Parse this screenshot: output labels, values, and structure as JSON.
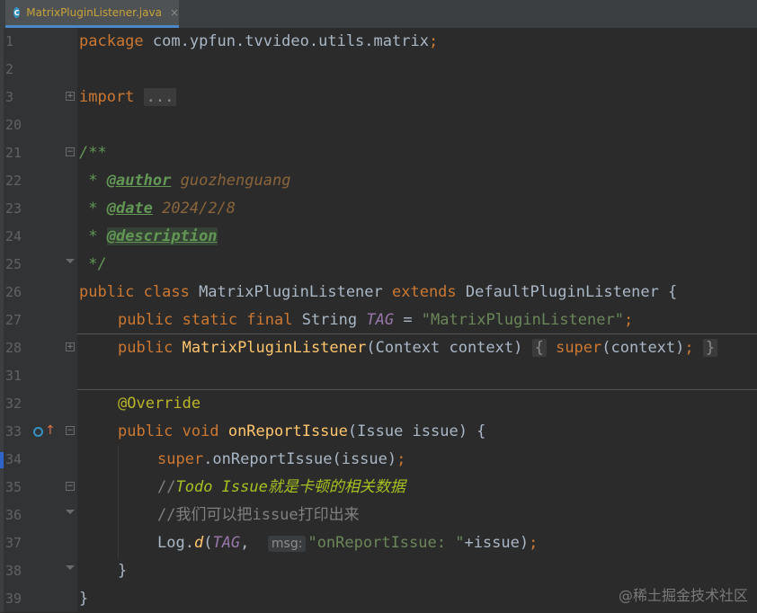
{
  "tab": {
    "icon": "java-class-icon",
    "icon_letter": "C",
    "label": "MatrixPluginListener.java",
    "close": "×"
  },
  "lines": [
    {
      "n": "1"
    },
    {
      "n": "2"
    },
    {
      "n": "3"
    },
    {
      "n": "20"
    },
    {
      "n": "21"
    },
    {
      "n": "22"
    },
    {
      "n": "23"
    },
    {
      "n": "24"
    },
    {
      "n": "25"
    },
    {
      "n": "26"
    },
    {
      "n": "27"
    },
    {
      "n": "28"
    },
    {
      "n": "31"
    },
    {
      "n": "32"
    },
    {
      "n": "33"
    },
    {
      "n": "34"
    },
    {
      "n": "35"
    },
    {
      "n": "36"
    },
    {
      "n": "37"
    },
    {
      "n": "38"
    },
    {
      "n": "39"
    }
  ],
  "code": {
    "l1_kw": "package",
    "l1_pkg": " com.ypfun.tvvideo.utils.matrix",
    "l1_semi": ";",
    "l3_kw": "import",
    "l3_folded": "...",
    "l21": "/**",
    "l22_star": " * ",
    "l22_tag": "@author",
    "l22_val": " guozhenguang",
    "l23_star": " * ",
    "l23_tag": "@date",
    "l23_val": " 2024/2/8",
    "l24_star": " * ",
    "l24_tag": "@description",
    "l25": " */",
    "l26_kw1": "public class ",
    "l26_name": "MatrixPluginListener ",
    "l26_kw2": "extends ",
    "l26_rest": "DefaultPluginListener {",
    "l27_kw": "public static final ",
    "l27_type": "String ",
    "l27_const": "TAG",
    "l27_eq": " = ",
    "l27_str": "\"MatrixPluginListener\"",
    "l27_semi": ";",
    "l28_kw": "public ",
    "l28_fn": "MatrixPluginListener",
    "l28_params": "(Context context) ",
    "l28_open": "{",
    "l28_kw2": " super",
    "l28_call": "(context)",
    "l28_semi": ";",
    "l28_close": "}",
    "l32": "@Override",
    "l33_kw": "public void ",
    "l33_fn": "onReportIssue",
    "l33_rest": "(Issue issue) {",
    "l34_kw": "super",
    "l34_rest": ".onReportIssue(issue)",
    "l34_semi": ";",
    "l35_slash": "//",
    "l35_todo": "Todo Issue就是卡顿的相关数据",
    "l36": "//我们可以把issue打印出来",
    "l37_a": "Log.",
    "l37_d": "d",
    "l37_b": "(",
    "l37_tag": "TAG",
    "l37_comma": ", ",
    "l37_hint": "msg:",
    "l37_str": "\"onReportIssue: \"",
    "l37_rest": "+issue)",
    "l37_semi": ";",
    "l38": "}",
    "l39": "}"
  },
  "watermark": "@稀土掘金技术社区"
}
